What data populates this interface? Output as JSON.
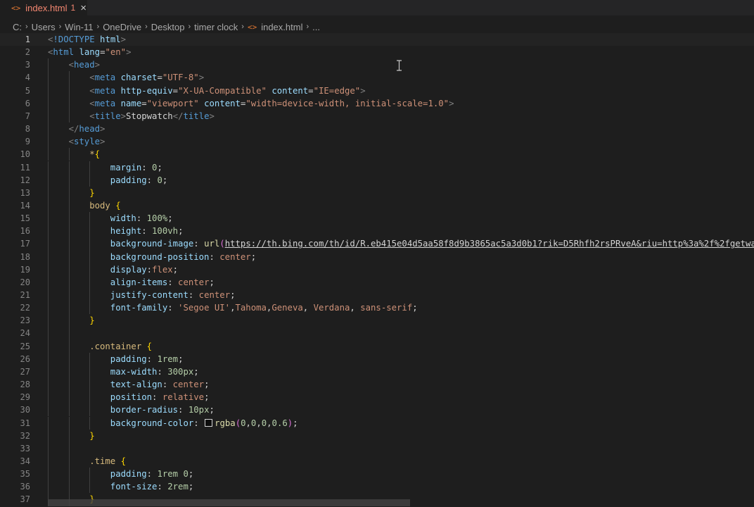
{
  "tab": {
    "icon": "<>",
    "name": "index.html",
    "problem_count": "1",
    "close_icon": "×"
  },
  "breadcrumb": [
    "C:",
    "Users",
    "Win-11",
    "OneDrive",
    "Desktop",
    "timer clock",
    "index.html",
    "..."
  ],
  "lines": [
    {
      "n": "1",
      "indent": 0,
      "t": [
        [
          "punct",
          "<"
        ],
        [
          "tag",
          "!DOCTYPE"
        ],
        [
          "text",
          " "
        ],
        [
          "attr",
          "html"
        ],
        [
          "punct",
          ">"
        ]
      ]
    },
    {
      "n": "2",
      "indent": 0,
      "t": [
        [
          "punct",
          "<"
        ],
        [
          "tag",
          "html"
        ],
        [
          "text",
          " "
        ],
        [
          "attr",
          "lang"
        ],
        [
          "text",
          "="
        ],
        [
          "str",
          "\"en\""
        ],
        [
          "punct",
          ">"
        ]
      ]
    },
    {
      "n": "3",
      "indent": 1,
      "t": [
        [
          "punct",
          "<"
        ],
        [
          "tag",
          "head"
        ],
        [
          "punct",
          ">"
        ]
      ]
    },
    {
      "n": "4",
      "indent": 2,
      "t": [
        [
          "punct",
          "<"
        ],
        [
          "tag",
          "meta"
        ],
        [
          "text",
          " "
        ],
        [
          "attr",
          "charset"
        ],
        [
          "text",
          "="
        ],
        [
          "str",
          "\"UTF-8\""
        ],
        [
          "punct",
          ">"
        ]
      ]
    },
    {
      "n": "5",
      "indent": 2,
      "t": [
        [
          "punct",
          "<"
        ],
        [
          "tag",
          "meta"
        ],
        [
          "text",
          " "
        ],
        [
          "attr",
          "http-equiv"
        ],
        [
          "text",
          "="
        ],
        [
          "str",
          "\"X-UA-Compatible\""
        ],
        [
          "text",
          " "
        ],
        [
          "attr",
          "content"
        ],
        [
          "text",
          "="
        ],
        [
          "str",
          "\"IE=edge\""
        ],
        [
          "punct",
          ">"
        ]
      ]
    },
    {
      "n": "6",
      "indent": 2,
      "t": [
        [
          "punct",
          "<"
        ],
        [
          "tag",
          "meta"
        ],
        [
          "text",
          " "
        ],
        [
          "attr",
          "name"
        ],
        [
          "text",
          "="
        ],
        [
          "str",
          "\"viewport\""
        ],
        [
          "text",
          " "
        ],
        [
          "attr",
          "content"
        ],
        [
          "text",
          "="
        ],
        [
          "str",
          "\"width=device-width, initial-scale=1.0\""
        ],
        [
          "punct",
          ">"
        ]
      ]
    },
    {
      "n": "7",
      "indent": 2,
      "t": [
        [
          "punct",
          "<"
        ],
        [
          "tag",
          "title"
        ],
        [
          "punct",
          ">"
        ],
        [
          "text",
          "Stopwatch"
        ],
        [
          "punct",
          "</"
        ],
        [
          "tag",
          "title"
        ],
        [
          "punct",
          ">"
        ]
      ]
    },
    {
      "n": "8",
      "indent": 1,
      "t": [
        [
          "punct",
          "</"
        ],
        [
          "tag",
          "head"
        ],
        [
          "punct",
          ">"
        ]
      ]
    },
    {
      "n": "9",
      "indent": 1,
      "t": [
        [
          "punct",
          "<"
        ],
        [
          "tag",
          "style"
        ],
        [
          "punct",
          ">"
        ]
      ]
    },
    {
      "n": "10",
      "indent": 2,
      "t": [
        [
          "sel",
          "*"
        ],
        [
          "brace",
          "{"
        ]
      ]
    },
    {
      "n": "11",
      "indent": 3,
      "t": [
        [
          "prop",
          "margin"
        ],
        [
          "text",
          ": "
        ],
        [
          "num",
          "0"
        ],
        [
          "text",
          ";"
        ]
      ]
    },
    {
      "n": "12",
      "indent": 3,
      "t": [
        [
          "prop",
          "padding"
        ],
        [
          "text",
          ": "
        ],
        [
          "num",
          "0"
        ],
        [
          "text",
          ";"
        ]
      ]
    },
    {
      "n": "13",
      "indent": 2,
      "t": [
        [
          "brace",
          "}"
        ]
      ]
    },
    {
      "n": "14",
      "indent": 2,
      "t": [
        [
          "sel",
          "body"
        ],
        [
          "text",
          " "
        ],
        [
          "brace",
          "{"
        ]
      ]
    },
    {
      "n": "15",
      "indent": 3,
      "t": [
        [
          "prop",
          "width"
        ],
        [
          "text",
          ": "
        ],
        [
          "num",
          "100%"
        ],
        [
          "text",
          ";"
        ]
      ]
    },
    {
      "n": "16",
      "indent": 3,
      "t": [
        [
          "prop",
          "height"
        ],
        [
          "text",
          ": "
        ],
        [
          "num",
          "100vh"
        ],
        [
          "text",
          ";"
        ]
      ]
    },
    {
      "n": "17",
      "indent": 3,
      "t": [
        [
          "prop",
          "background-image"
        ],
        [
          "text",
          ": "
        ],
        [
          "fn",
          "url"
        ],
        [
          "paren",
          "("
        ],
        [
          "url",
          "https://th.bing.com/th/id/R.eb415e04d5aa58f8d9b3865ac5a3d0b1?rik=D5Rhfh2rsPRveA&riu=http%3a%2f%2fgetwallpapers"
        ]
      ]
    },
    {
      "n": "18",
      "indent": 3,
      "t": [
        [
          "prop",
          "background-position"
        ],
        [
          "text",
          ": "
        ],
        [
          "val",
          "center"
        ],
        [
          "text",
          ";"
        ]
      ]
    },
    {
      "n": "19",
      "indent": 3,
      "t": [
        [
          "prop",
          "display"
        ],
        [
          "text",
          ":"
        ],
        [
          "val",
          "flex"
        ],
        [
          "text",
          ";"
        ]
      ]
    },
    {
      "n": "20",
      "indent": 3,
      "t": [
        [
          "prop",
          "align-items"
        ],
        [
          "text",
          ": "
        ],
        [
          "val",
          "center"
        ],
        [
          "text",
          ";"
        ]
      ]
    },
    {
      "n": "21",
      "indent": 3,
      "t": [
        [
          "prop",
          "justify-content"
        ],
        [
          "text",
          ": "
        ],
        [
          "val",
          "center"
        ],
        [
          "text",
          ";"
        ]
      ]
    },
    {
      "n": "22",
      "indent": 3,
      "t": [
        [
          "prop",
          "font-family"
        ],
        [
          "text",
          ": "
        ],
        [
          "val",
          "'Segoe UI'"
        ],
        [
          "text",
          ","
        ],
        [
          "val",
          "Tahoma"
        ],
        [
          "text",
          ","
        ],
        [
          "val",
          "Geneva"
        ],
        [
          "text",
          ", "
        ],
        [
          "val",
          "Verdana"
        ],
        [
          "text",
          ", "
        ],
        [
          "val",
          "sans-serif"
        ],
        [
          "text",
          ";"
        ]
      ]
    },
    {
      "n": "23",
      "indent": 2,
      "t": [
        [
          "brace",
          "}"
        ]
      ]
    },
    {
      "n": "24",
      "indent": 2,
      "t": []
    },
    {
      "n": "25",
      "indent": 2,
      "t": [
        [
          "sel",
          ".container"
        ],
        [
          "text",
          " "
        ],
        [
          "brace",
          "{"
        ]
      ]
    },
    {
      "n": "26",
      "indent": 3,
      "t": [
        [
          "prop",
          "padding"
        ],
        [
          "text",
          ": "
        ],
        [
          "num",
          "1rem"
        ],
        [
          "text",
          ";"
        ]
      ]
    },
    {
      "n": "27",
      "indent": 3,
      "t": [
        [
          "prop",
          "max-width"
        ],
        [
          "text",
          ": "
        ],
        [
          "num",
          "300px"
        ],
        [
          "text",
          ";"
        ]
      ]
    },
    {
      "n": "28",
      "indent": 3,
      "t": [
        [
          "prop",
          "text-align"
        ],
        [
          "text",
          ": "
        ],
        [
          "val",
          "center"
        ],
        [
          "text",
          ";"
        ]
      ]
    },
    {
      "n": "29",
      "indent": 3,
      "t": [
        [
          "prop",
          "position"
        ],
        [
          "text",
          ": "
        ],
        [
          "val",
          "relative"
        ],
        [
          "text",
          ";"
        ]
      ]
    },
    {
      "n": "30",
      "indent": 3,
      "t": [
        [
          "prop",
          "border-radius"
        ],
        [
          "text",
          ": "
        ],
        [
          "num",
          "10px"
        ],
        [
          "text",
          ";"
        ]
      ]
    },
    {
      "n": "31",
      "indent": 3,
      "t": [
        [
          "prop",
          "background-color"
        ],
        [
          "text",
          ": "
        ],
        [
          "swatch",
          ""
        ],
        [
          "fn",
          "rgba"
        ],
        [
          "paren",
          "("
        ],
        [
          "num",
          "0"
        ],
        [
          "text",
          ","
        ],
        [
          "num",
          "0"
        ],
        [
          "text",
          ","
        ],
        [
          "num",
          "0"
        ],
        [
          "text",
          ","
        ],
        [
          "num",
          "0.6"
        ],
        [
          "paren",
          ")"
        ],
        [
          "text",
          ";"
        ]
      ]
    },
    {
      "n": "32",
      "indent": 2,
      "t": [
        [
          "brace",
          "}"
        ]
      ]
    },
    {
      "n": "33",
      "indent": 2,
      "t": []
    },
    {
      "n": "34",
      "indent": 2,
      "t": [
        [
          "sel",
          ".time"
        ],
        [
          "text",
          " "
        ],
        [
          "brace",
          "{"
        ]
      ]
    },
    {
      "n": "35",
      "indent": 3,
      "t": [
        [
          "prop",
          "padding"
        ],
        [
          "text",
          ": "
        ],
        [
          "num",
          "1rem"
        ],
        [
          "text",
          " "
        ],
        [
          "num",
          "0"
        ],
        [
          "text",
          ";"
        ]
      ]
    },
    {
      "n": "36",
      "indent": 3,
      "t": [
        [
          "prop",
          "font-size"
        ],
        [
          "text",
          ": "
        ],
        [
          "num",
          "2rem"
        ],
        [
          "text",
          ";"
        ]
      ]
    },
    {
      "n": "37",
      "indent": 2,
      "t": [
        [
          "brace",
          "}"
        ]
      ]
    }
  ],
  "active_line": "1",
  "colors": {
    "editor_bg": "#1e1e1e",
    "tag": "#569cd6",
    "attr": "#9cdcfe",
    "string": "#ce9178",
    "selector": "#d7ba7d",
    "number": "#b5cea8",
    "brace": "#ffd700"
  },
  "icons": {
    "file": "html-file-icon",
    "close": "close-icon",
    "breadcrumb_sep": "chevron-right-icon",
    "cursor": "text-cursor-icon"
  }
}
